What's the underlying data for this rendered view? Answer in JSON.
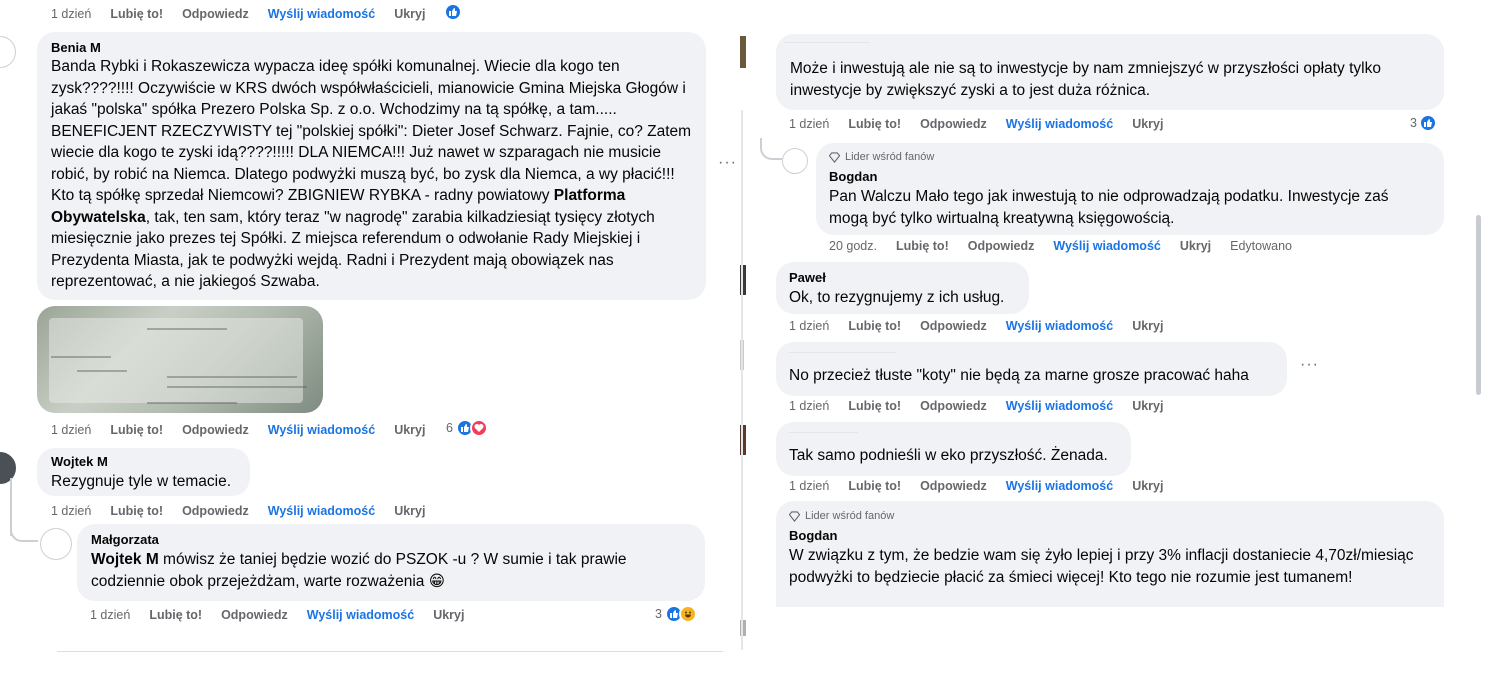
{
  "actions_common": {
    "like": "Lubię to!",
    "reply": "Odpowiedz",
    "message": "Wyślij wiadomość",
    "hide": "Ukryj",
    "edited": "Edytowano"
  },
  "fan_badge_label": "Lider wśród fanów",
  "top_actions": {
    "time": "1 dzień"
  },
  "left": {
    "c1": {
      "author": "Benia M",
      "time": "1 dzień",
      "reactions_count": "6",
      "text_parts": [
        "Banda Rybki i Rokaszewicza wypacza ideę spółki komunalnej. Wiecie dla kogo ten zysk????!!!! Oczywiście w KRS dwóch współwłaścicieli, mianowicie Gmina Miejska Głogów i jakaś \"polska\" spółka Prezero Polska Sp. z o.o. Wchodzimy na tą spółkę, a tam..... BENEFICJENT RZECZYWISTY tej \"polskiej spółki\": Dieter Josef Schwarz. Fajnie, co? Zatem wiecie dla kogo te zyski idą????!!!!! DLA NIEMCA!!! Już nawet w szparagach nie musicie robić, by robić na Niemca. Dlatego podwyżki muszą być, bo zysk dla Niemca, a wy płacić!!! Kto tą spółkę sprzedał Niemcowi? ZBIGNIEW RYBKA - radny powiatowy ",
        "Platforma Obywatelska",
        ", tak, ten sam, który teraz \"w nagrodę\" zarabia kilkadziesiąt tysięcy złotych miesięcznie jako prezes tej Spółki. Z miejsca referendum o odwołanie Rady Miejskiej i Prezydenta Miasta, jak te podwyżki wejdą. Radni i Prezydent mają obowiązek nas reprezentować, a nie jakiegoś Szwaba."
      ]
    },
    "c2": {
      "author": "Wojtek M",
      "text": "Rezygnuje tyle w temacie.",
      "time": "1 dzień"
    },
    "c3": {
      "author": "Małgorzata",
      "mention": "Wojtek M",
      "text": " mówisz że taniej będzie wozić do PSZOK -u ? W sumie i tak prawie codziennie obok przejeżdżam, warte rozważenia 😁",
      "time": "1 dzień",
      "reactions_count": "3"
    }
  },
  "right": {
    "r1": {
      "text": "Może i inwestują ale nie są to inwestycje by nam zmniejszyć w przyszłości opłaty tylko inwestycje by zwiększyć zyski a to jest duża różnica.",
      "time": "1 dzień",
      "reactions_count": "3"
    },
    "r2": {
      "author": "Bogdan",
      "text": "Pan Walczu Mało tego jak inwestują to nie odprowadzają podatku. Inwestycje zaś mogą być tylko wirtualną kreatywną księgowością.",
      "time": "20 godz."
    },
    "r3": {
      "author": "Paweł",
      "text": "Ok, to rezygnujemy z ich usług.",
      "time": "1 dzień"
    },
    "r4": {
      "text": "No przecież tłuste \"koty\" nie będą za marne grosze pracować haha",
      "time": "1 dzień"
    },
    "r5": {
      "text": "Tak samo podnieśli w eko przyszłość. Żenada.",
      "time": "1 dzień"
    },
    "r6": {
      "author": "Bogdan",
      "text": "W związku z tym, że bedzie wam się żyło lepiej i przy 3% inflacji dostaniecie 4,70zł/miesiąc podwyżki to będziecie płacić za śmieci więcej! Kto tego nie rozumie jest tumanem!"
    }
  },
  "icons": {
    "like": "like-icon",
    "love": "love-icon",
    "haha": "haha-icon",
    "diamond": "diamond-icon",
    "more": "more-icon"
  },
  "colors": {
    "bubble": "#f0f2f5",
    "link": "#1b74e4",
    "muted": "#65676b",
    "like": "#1b74e4",
    "love": "#f33e58"
  }
}
